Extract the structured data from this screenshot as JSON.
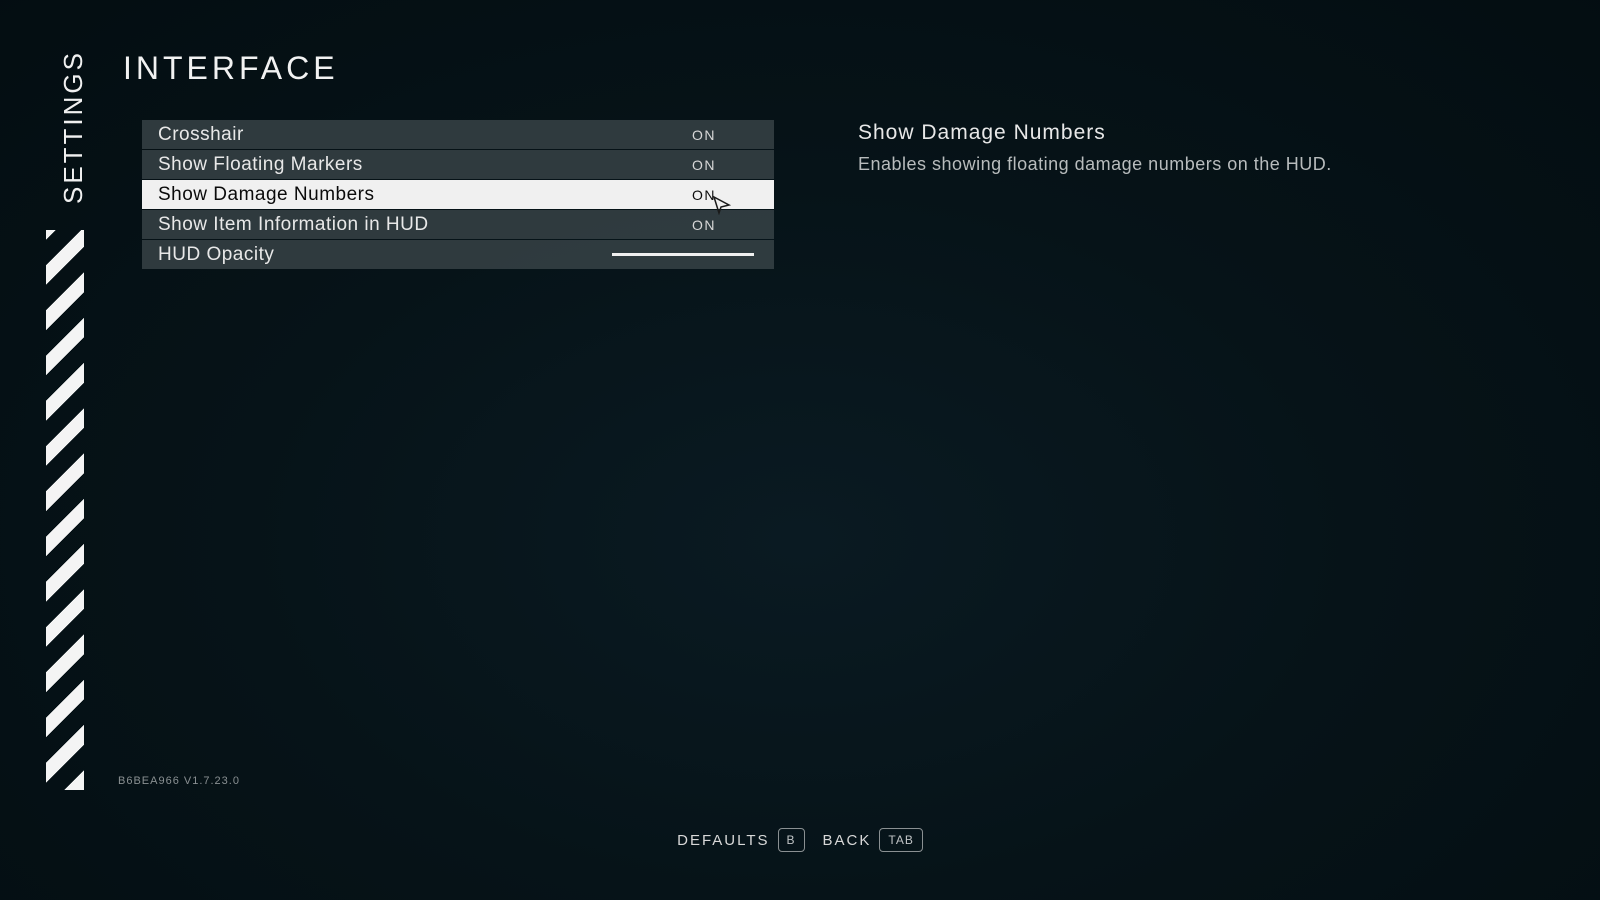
{
  "sidebar": {
    "label": "SETTINGS"
  },
  "page": {
    "title": "INTERFACE"
  },
  "options": [
    {
      "label": "Crosshair",
      "value": "ON",
      "type": "toggle",
      "selected": false
    },
    {
      "label": "Show Floating Markers",
      "value": "ON",
      "type": "toggle",
      "selected": false
    },
    {
      "label": "Show Damage Numbers",
      "value": "ON",
      "type": "toggle",
      "selected": true
    },
    {
      "label": "Show Item Information in HUD",
      "value": "ON",
      "type": "toggle",
      "selected": false
    },
    {
      "label": "HUD Opacity",
      "value": 100,
      "type": "slider",
      "selected": false
    }
  ],
  "description": {
    "title": "Show Damage Numbers",
    "body": "Enables showing floating damage numbers on the HUD."
  },
  "build": "B6BEA966 V1.7.23.0",
  "footer": {
    "defaults": {
      "label": "DEFAULTS",
      "key": "B"
    },
    "back": {
      "label": "BACK",
      "key": "TAB"
    }
  }
}
